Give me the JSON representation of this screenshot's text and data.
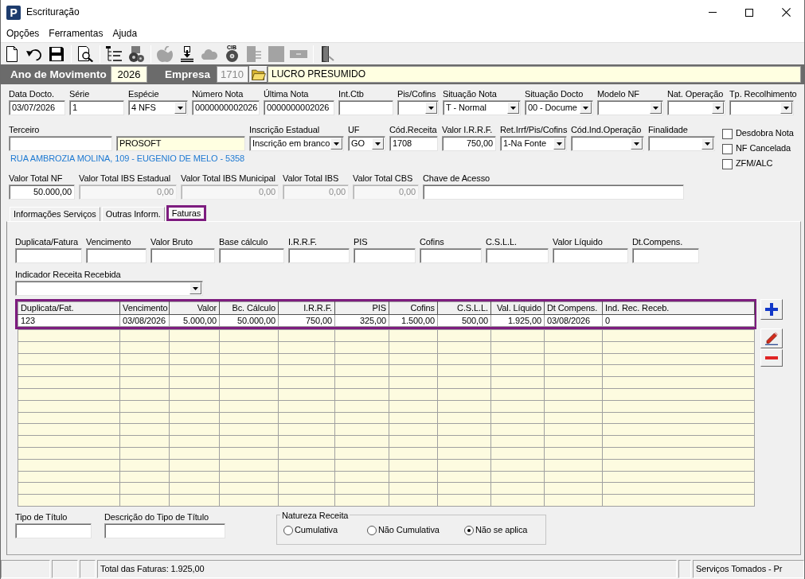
{
  "window": {
    "logo": "P",
    "title": "Escrituração"
  },
  "menu": [
    {
      "label": "Opções"
    },
    {
      "label": "Ferramentas"
    },
    {
      "label": "Ajuda"
    }
  ],
  "toolbar": {
    "groups": [
      [
        {
          "disabled": false
        },
        {
          "disabled": false
        },
        {
          "disabled": false
        }
      ],
      [
        {
          "disabled": false
        }
      ],
      [
        {
          "disabled": false
        },
        {
          "disabled": false
        }
      ],
      [
        {
          "disabled": true
        },
        {
          "disabled": false
        },
        {
          "disabled": true
        },
        {
          "disabled": false,
          "label": "CIB"
        },
        {
          "disabled": true
        },
        {
          "disabled": true
        },
        {
          "disabled": true
        }
      ],
      [
        {
          "disabled": false
        }
      ]
    ]
  },
  "header": {
    "year_label": "Ano de Movimento",
    "year": "2026",
    "company_label": "Empresa",
    "company_code": {
      "value": "1710",
      "disabled": true
    },
    "company_name": "LUCRO PRESUMIDO"
  },
  "form": {
    "row_1": [
      {
        "label": "Data Docto.",
        "kind": "text",
        "value": "03/07/2026"
      },
      {
        "label": "Série",
        "kind": "text",
        "value": "1"
      },
      {
        "label": "Espécie",
        "kind": "select",
        "value": "4 NFS"
      },
      {
        "label": "Número Nota",
        "kind": "text",
        "value": "0000000002026"
      },
      {
        "label": "Última Nota",
        "kind": "text",
        "value": "0000000002026"
      },
      {
        "label": "Int.Ctb",
        "kind": "text"
      },
      {
        "label": "Pis/Cofins",
        "kind": "select"
      },
      {
        "label": "Situação Nota",
        "kind": "select",
        "value": "T - Normal"
      },
      {
        "label": "Situação Docto",
        "kind": "select",
        "value": "00 - Docume"
      },
      {
        "label": "Modelo NF",
        "kind": "select"
      },
      {
        "label": "Nat. Operação",
        "kind": "select"
      },
      {
        "label": "Tp. Recolhimento",
        "kind": "select"
      }
    ],
    "row_2": [
      {
        "label": "Terceiro",
        "kind": "text"
      },
      {
        "kind": "readonly",
        "value": "PROSOFT"
      },
      {
        "label": "Inscrição Estadual",
        "kind": "select",
        "value": "Inscrição em branco"
      },
      {
        "label": "UF",
        "kind": "select",
        "value": "GO"
      },
      {
        "label": "Cód.Receita",
        "kind": "text",
        "value": "1708"
      },
      {
        "label": "Valor I.R.R.F.",
        "kind": "number",
        "value": "750,00"
      },
      {
        "label": "Ret.Irrf/Pis/Cofins",
        "kind": "select",
        "value": "1-Na Fonte"
      },
      {
        "label": "Cód.Ind.Operação",
        "kind": "select"
      },
      {
        "label": "Finalidade",
        "kind": "select"
      }
    ],
    "address": "RUA AMBROZIA MOLINA, 109 - EUGENIO DE MELO - 5358",
    "flags": [
      {
        "label": "Desdobra Nota",
        "checked": false
      },
      {
        "label": "NF Cancelada",
        "checked": false
      },
      {
        "label": "ZFM/ALC",
        "checked": false
      }
    ],
    "row_3": [
      {
        "label": "Valor Total NF",
        "kind": "number",
        "value": "50.000,00",
        "disabled": false
      },
      {
        "label": "Valor Total IBS Estadual",
        "kind": "number",
        "value": "0,00",
        "disabled": true
      },
      {
        "label": "Valor Total IBS Municipal",
        "kind": "number",
        "value": "0,00",
        "disabled": true
      },
      {
        "label": "Valor Total IBS",
        "kind": "number",
        "value": "0,00",
        "disabled": true
      },
      {
        "label": "Valor Total CBS",
        "kind": "number",
        "value": "0,00",
        "disabled": true
      },
      {
        "label": "Chave de Acesso",
        "kind": "text",
        "disabled": false
      }
    ]
  },
  "tabs": [
    {
      "label": "Informações Serviços",
      "selected": false,
      "highlighted": false
    },
    {
      "label": "Outras Inform.",
      "selected": false,
      "highlighted": false
    },
    {
      "label": "Faturas",
      "selected": true,
      "highlighted": true
    }
  ],
  "faturas": {
    "entry_fields": [
      {
        "label": "Duplicata/Fatura",
        "kind": "text"
      },
      {
        "label": "Vencimento",
        "kind": "text"
      },
      {
        "label": "Valor Bruto",
        "kind": "text"
      },
      {
        "label": "Base cálculo",
        "kind": "text"
      },
      {
        "label": "I.R.R.F.",
        "kind": "text"
      },
      {
        "label": "PIS",
        "kind": "text"
      },
      {
        "label": "Cofins",
        "kind": "text"
      },
      {
        "label": "C.S.L.L.",
        "kind": "text"
      },
      {
        "label": "Valor Líquido",
        "kind": "text"
      },
      {
        "label": "Dt.Compens.",
        "kind": "text"
      }
    ],
    "receipt_indicator": {
      "label": "Indicador Receita Recebida",
      "kind": "select"
    },
    "table": {
      "highlighted": true,
      "columns": [
        {
          "label": "Duplicata/Fat.",
          "kind": "text"
        },
        {
          "label": "Vencimento",
          "kind": "text"
        },
        {
          "label": "Valor",
          "kind": "number"
        },
        {
          "label": "Bc. Cálculo",
          "kind": "number"
        },
        {
          "label": "I.R.R.F.",
          "kind": "number"
        },
        {
          "label": "PIS",
          "kind": "number"
        },
        {
          "label": "Cofins",
          "kind": "number"
        },
        {
          "label": "C.S.L.L.",
          "kind": "number"
        },
        {
          "label": "Val. Líquido",
          "kind": "number"
        },
        {
          "label": "Dt Compens.",
          "kind": "text"
        },
        {
          "label": "Ind. Rec. Receb.",
          "kind": "text"
        }
      ],
      "rows": [
        {
          "cells": [
            "123",
            "03/08/2026",
            "5.000,00",
            "50.000,00",
            "750,00",
            "325,00",
            "1.500,00",
            "500,00",
            "1.925,00",
            "03/08/2026",
            "0"
          ]
        }
      ]
    },
    "title_type": {
      "label": "Tipo de Título",
      "kind": "text"
    },
    "title_description": {
      "label": "Descrição do Tipo de Título",
      "kind": "text"
    },
    "revenue_nature": {
      "legend": "Natureza Receita",
      "options": [
        {
          "label": "Cumulativa",
          "selected": false
        },
        {
          "label": "Não Cumulativa",
          "selected": false
        },
        {
          "label": "Não se aplica",
          "selected": true
        }
      ]
    }
  },
  "status_bar": {
    "total": "Total das Faturas: 1.925,00",
    "mode": "Serviços Tomados - Pr"
  }
}
